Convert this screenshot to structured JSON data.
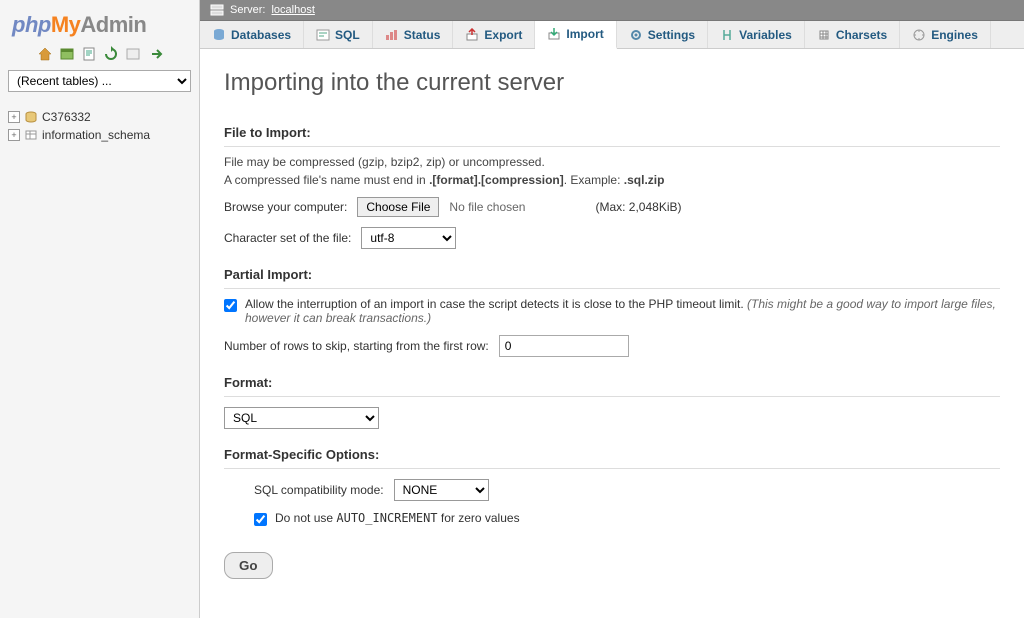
{
  "logo": {
    "p1": "php",
    "p2": "My",
    "p3": "Admin"
  },
  "recent_placeholder": "(Recent tables) ...",
  "databases": [
    "C376332",
    "information_schema"
  ],
  "breadcrumb": {
    "label": "Server:",
    "value": "localhost"
  },
  "tabs": {
    "databases": "Databases",
    "sql": "SQL",
    "status": "Status",
    "export": "Export",
    "import": "Import",
    "settings": "Settings",
    "variables": "Variables",
    "charsets": "Charsets",
    "engines": "Engines"
  },
  "title": "Importing into the current server",
  "sections": {
    "file_to_import": "File to Import:",
    "partial_import": "Partial Import:",
    "format": "Format:",
    "format_specific": "Format-Specific Options:"
  },
  "text": {
    "compress_line": "File may be compressed (gzip, bzip2, zip) or uncompressed.",
    "compress_line2a": "A compressed file's name must end in ",
    "compress_bold": ".[format].[compression]",
    "compress_line2b": ". Example: ",
    "compress_example": ".sql.zip",
    "browse_label": "Browse your computer:",
    "choose_file": "Choose File",
    "no_file": "No file chosen",
    "max": "(Max: 2,048KiB)",
    "charset_label": "Character set of the file:",
    "charset_value": "utf-8",
    "allow_interrupt_a": "Allow the interruption of an import in case the script detects it is close to the PHP timeout limit. ",
    "allow_interrupt_hint": "(This might be a good way to import large files, however it can break transactions.)",
    "rows_skip_label": "Number of rows to skip, starting from the first row:",
    "rows_skip_value": "0",
    "format_value": "SQL",
    "sql_compat_label": "SQL compatibility mode:",
    "sql_compat_value": "NONE",
    "noautoinc_a": "Do not use ",
    "noautoinc_code": "AUTO_INCREMENT",
    "noautoinc_b": " for zero values",
    "go": "Go"
  }
}
